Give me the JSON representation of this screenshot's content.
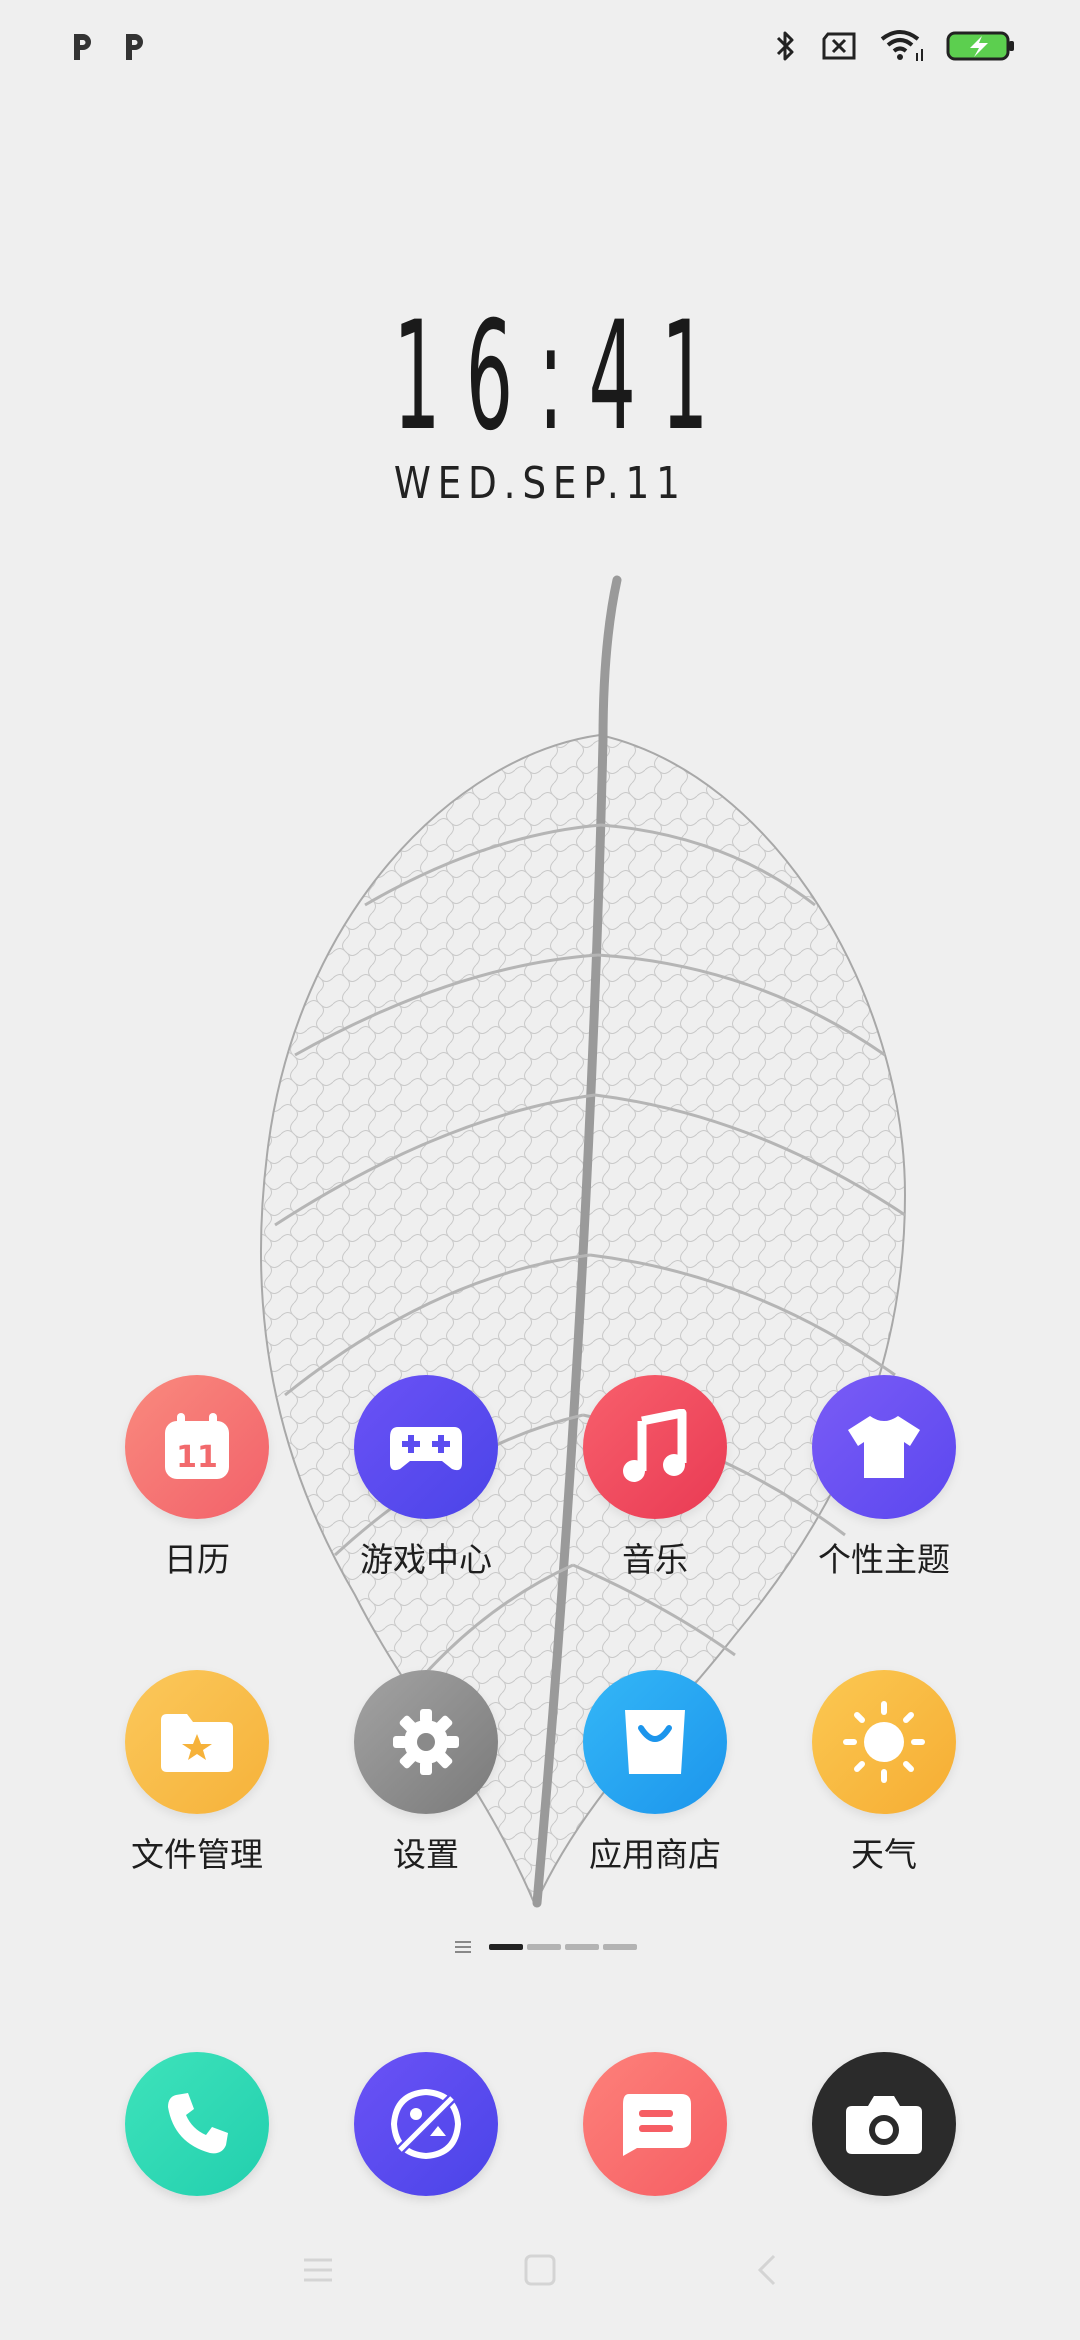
{
  "clock": {
    "time": "16:41",
    "date": "WED.SEP.11"
  },
  "apps": [
    {
      "label": "日历",
      "icon": "calendar-icon",
      "badge": "11",
      "color": "#f7726e"
    },
    {
      "label": "游戏中心",
      "icon": "gamepad-icon",
      "color": "#5b4df0"
    },
    {
      "label": "音乐",
      "icon": "music-note-icon",
      "color": "#f24a60"
    },
    {
      "label": "个性主题",
      "icon": "tshirt-icon",
      "color": "#6a52f2"
    },
    {
      "label": "文件管理",
      "icon": "folder-star-icon",
      "color": "#f8bd48"
    },
    {
      "label": "设置",
      "icon": "gear-icon",
      "color": "#8c8c8c"
    },
    {
      "label": "应用商店",
      "icon": "shopping-bag-icon",
      "color": "#2aa7f3"
    },
    {
      "label": "天气",
      "icon": "sun-icon",
      "color": "#f9bd42"
    }
  ],
  "dock": [
    {
      "icon": "phone-icon",
      "color": "#2ad9b4"
    },
    {
      "icon": "gallery-icon",
      "color": "#5b4df0"
    },
    {
      "icon": "messages-icon",
      "color": "#fb6f6a"
    },
    {
      "icon": "camera-icon",
      "color": "#2b2b2b"
    }
  ],
  "page_indicator": {
    "pages": 4,
    "current": 1
  }
}
